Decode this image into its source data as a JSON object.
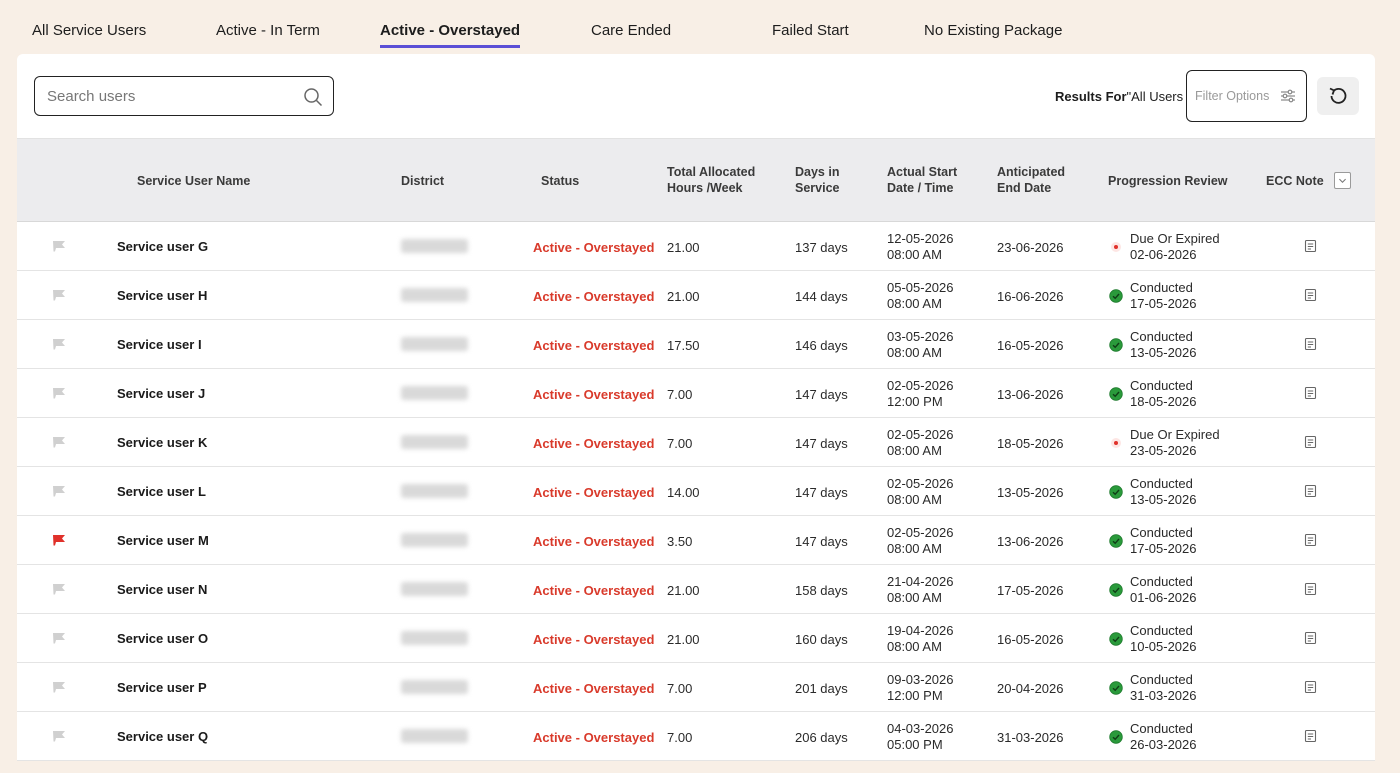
{
  "tabs": [
    {
      "label": "All Service Users",
      "active": false
    },
    {
      "label": "Active - In Term",
      "active": false
    },
    {
      "label": "Active - Overstayed",
      "active": true
    },
    {
      "label": "Care Ended",
      "active": false
    },
    {
      "label": "Failed Start",
      "active": false
    },
    {
      "label": "No Existing Package",
      "active": false
    }
  ],
  "search": {
    "placeholder": "Search users",
    "icon": "search-icon"
  },
  "results": {
    "label": "Results For",
    "value": "\"All Users"
  },
  "filter": {
    "label": "Filter Options",
    "icon": "sliders-icon"
  },
  "refresh": {
    "icon": "refresh-icon"
  },
  "colors": {
    "accent": "#5b4fd6",
    "status": "#d93a2b",
    "conducted": "#2a9a3b",
    "due": "#e0312a"
  },
  "columns": {
    "name": "Service User Name",
    "district": "District",
    "status": "Status",
    "hours": "Total Allocated\nHours /Week",
    "days": "Days in\nService",
    "start": "Actual Start\nDate / Time",
    "end": "Anticipated\nEnd Date",
    "progression": "Progression Review",
    "ecc": "ECC Note"
  },
  "rows": [
    {
      "flagged": false,
      "name": "Service user G",
      "status": "Active - Overstayed",
      "hours": "21.00",
      "days": "137 days",
      "start_date": "12-05-2026",
      "start_time": "08:00 AM",
      "end": "23-06-2026",
      "review_state": "due",
      "review_label": "Due Or Expired",
      "review_date": "02-06-2026"
    },
    {
      "flagged": false,
      "name": "Service user H",
      "status": "Active - Overstayed",
      "hours": "21.00",
      "days": "144 days",
      "start_date": "05-05-2026",
      "start_time": "08:00 AM",
      "end": "16-06-2026",
      "review_state": "conducted",
      "review_label": "Conducted",
      "review_date": "17-05-2026"
    },
    {
      "flagged": false,
      "name": "Service user I",
      "status": "Active - Overstayed",
      "hours": "17.50",
      "days": "146 days",
      "start_date": "03-05-2026",
      "start_time": "08:00 AM",
      "end": "16-05-2026",
      "review_state": "conducted",
      "review_label": "Conducted",
      "review_date": "13-05-2026"
    },
    {
      "flagged": false,
      "name": "Service user J",
      "status": "Active - Overstayed",
      "hours": "7.00",
      "days": "147 days",
      "start_date": "02-05-2026",
      "start_time": "12:00 PM",
      "end": "13-06-2026",
      "review_state": "conducted",
      "review_label": "Conducted",
      "review_date": "18-05-2026"
    },
    {
      "flagged": false,
      "name": "Service user K",
      "status": "Active - Overstayed",
      "hours": "7.00",
      "days": "147 days",
      "start_date": "02-05-2026",
      "start_time": "08:00 AM",
      "end": "18-05-2026",
      "review_state": "due",
      "review_label": "Due Or Expired",
      "review_date": "23-05-2026"
    },
    {
      "flagged": false,
      "name": "Service user L",
      "status": "Active - Overstayed",
      "hours": "14.00",
      "days": "147 days",
      "start_date": "02-05-2026",
      "start_time": "08:00 AM",
      "end": "13-05-2026",
      "review_state": "conducted",
      "review_label": "Conducted",
      "review_date": "13-05-2026"
    },
    {
      "flagged": true,
      "name": "Service user M",
      "status": "Active - Overstayed",
      "hours": "3.50",
      "days": "147 days",
      "start_date": "02-05-2026",
      "start_time": "08:00 AM",
      "end": "13-06-2026",
      "review_state": "conducted",
      "review_label": "Conducted",
      "review_date": "17-05-2026"
    },
    {
      "flagged": false,
      "name": "Service user N",
      "status": "Active - Overstayed",
      "hours": "21.00",
      "days": "158 days",
      "start_date": "21-04-2026",
      "start_time": "08:00 AM",
      "end": "17-05-2026",
      "review_state": "conducted",
      "review_label": "Conducted",
      "review_date": "01-06-2026"
    },
    {
      "flagged": false,
      "name": "Service user O",
      "status": "Active - Overstayed",
      "hours": "21.00",
      "days": "160 days",
      "start_date": "19-04-2026",
      "start_time": "08:00 AM",
      "end": "16-05-2026",
      "review_state": "conducted",
      "review_label": "Conducted",
      "review_date": "10-05-2026"
    },
    {
      "flagged": false,
      "name": "Service user P",
      "status": "Active - Overstayed",
      "hours": "7.00",
      "days": "201 days",
      "start_date": "09-03-2026",
      "start_time": "12:00 PM",
      "end": "20-04-2026",
      "review_state": "conducted",
      "review_label": "Conducted",
      "review_date": "31-03-2026"
    },
    {
      "flagged": false,
      "name": "Service user Q",
      "status": "Active - Overstayed",
      "hours": "7.00",
      "days": "206 days",
      "start_date": "04-03-2026",
      "start_time": "05:00 PM",
      "end": "31-03-2026",
      "review_state": "conducted",
      "review_label": "Conducted",
      "review_date": "26-03-2026"
    }
  ]
}
